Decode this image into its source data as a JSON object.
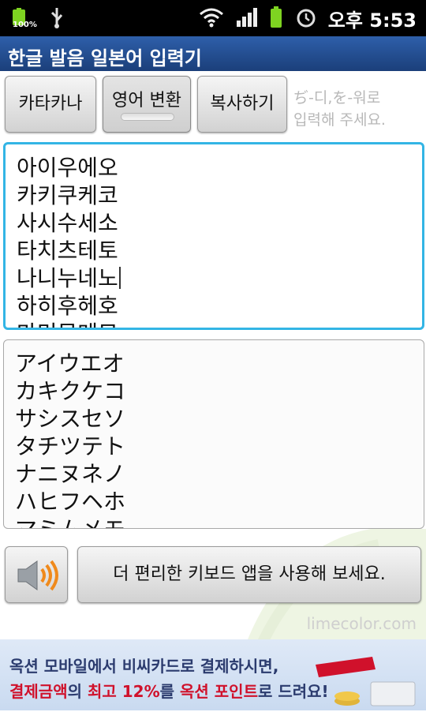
{
  "status_bar": {
    "battery_percent": "100%",
    "time": "오후 5:53",
    "icons": [
      "battery-icon",
      "usb-icon",
      "wifi-icon",
      "signal-icon",
      "battery-full-icon",
      "alarm-icon"
    ]
  },
  "app": {
    "title": "한글 발음 일본어 입력기"
  },
  "buttons": {
    "katakana": "카타카나",
    "english_convert": "영어 변환",
    "copy": "복사하기"
  },
  "hint": {
    "line1": "ぢ-디,を-워로",
    "line2": "입력해 주세요."
  },
  "input_text": [
    "아이우에오",
    "카키쿠케코",
    "사시수세소",
    "타치츠테토",
    "나니누네노",
    "하히후헤호",
    "마미무메모"
  ],
  "output_text": [
    "アイウエオ",
    "カキクケコ",
    "サシスセソ",
    "タチツテト",
    "ナニヌネノ",
    "ハヒフヘホ",
    "マミムメモ"
  ],
  "keyboard_prompt": "더 편리한 키보드 앱을 사용해 보세요.",
  "watermark": "limecolor.com",
  "ad": {
    "line1": "옥션 모바일에서 비씨카드로 결제하시면,",
    "line2_a": "결제금액",
    "line2_b": "의 ",
    "line2_c": "최고 12%",
    "line2_d": "를 ",
    "line2_e": "옥션 포인트",
    "line2_f": "로 드려요!"
  },
  "colors": {
    "title_bar": "#1b3f7a",
    "focus_border": "#33b5e5",
    "ad_red": "#d0112b"
  }
}
